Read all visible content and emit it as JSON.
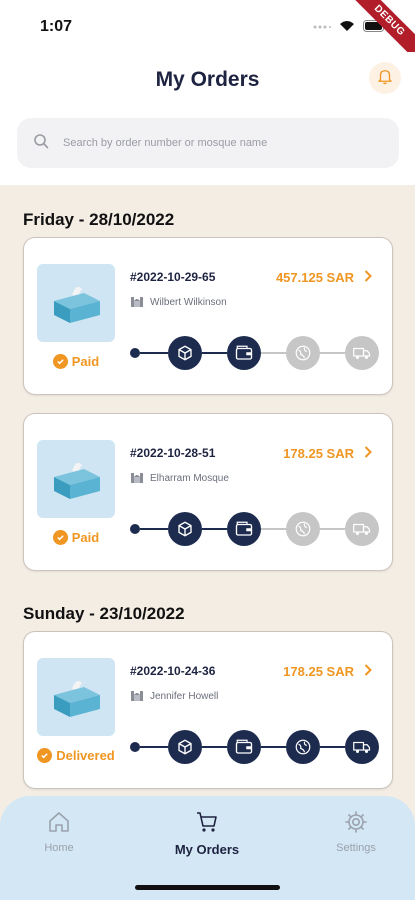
{
  "status_bar": {
    "time": "1:07",
    "debug_label": "DEBUG"
  },
  "header": {
    "title": "My Orders"
  },
  "search": {
    "placeholder": "Search by order number or mosque name"
  },
  "groups": [
    {
      "date": "Friday - 28/10/2022",
      "orders": [
        {
          "number": "#2022-10-29-65",
          "mosque": "Wilbert Wilkinson",
          "price": "457.125 SAR",
          "status": "Paid",
          "progress_completed_steps": 2
        },
        {
          "number": "#2022-10-28-51",
          "mosque": "Elharram Mosque",
          "price": "178.25 SAR",
          "status": "Paid",
          "progress_completed_steps": 2
        }
      ]
    },
    {
      "date": "Sunday - 23/10/2022",
      "orders": [
        {
          "number": "#2022-10-24-36",
          "mosque": "Jennifer Howell",
          "price": "178.25 SAR",
          "status": "Delivered",
          "progress_completed_steps": 4
        }
      ]
    }
  ],
  "progress_steps": [
    "box-icon",
    "wallet-icon",
    "globe-icon",
    "truck-icon"
  ],
  "tabs": [
    {
      "label": "Home",
      "icon": "home-icon",
      "active": false
    },
    {
      "label": "My Orders",
      "icon": "cart-icon",
      "active": true
    },
    {
      "label": "Settings",
      "icon": "gear-icon",
      "active": false
    }
  ],
  "colors": {
    "accent": "#ef9623",
    "navy": "#1d2b4f",
    "inactive": "#c6c6c6",
    "content_bg": "#f4ede4",
    "tabbar_bg": "#d4e7f4"
  }
}
